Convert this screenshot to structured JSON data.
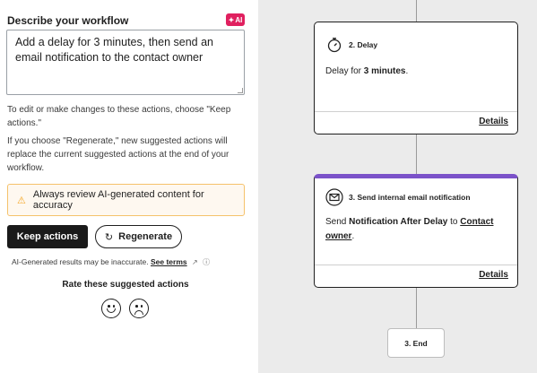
{
  "panel": {
    "title": "Describe your workflow",
    "ai_badge": "AI",
    "prompt_value": "Add a delay for 3 minutes, then send an email notification to the contact owner",
    "help_text_1": "To edit or make changes to these actions, choose \"Keep actions.\"",
    "help_text_2": "If you choose \"Regenerate,\" new suggested actions will replace the current suggested actions at the end of your workflow.",
    "alert_text": "Always review AI-generated content for accuracy",
    "keep_label": "Keep actions",
    "regenerate_label": "Regenerate",
    "disclaimer_text": "AI-Generated results may be inaccurate.",
    "see_terms": "See terms",
    "rate_title": "Rate these suggested actions"
  },
  "canvas": {
    "delay_card": {
      "title": "2. Delay",
      "body_prefix": "Delay for ",
      "body_bold": "3 minutes",
      "body_suffix": ".",
      "details": "Details"
    },
    "email_card": {
      "title": "3. Send internal email notification",
      "body_prefix": "Send ",
      "body_bold": "Notification After Delay",
      "body_mid": " to ",
      "body_link": "Contact owner",
      "body_suffix": ".",
      "details": "Details",
      "accent_color": "#7b52c9"
    },
    "end_node": "3. End"
  },
  "colors": {
    "ai_badge": "#e0205f",
    "alert_border": "#f5c26b",
    "alert_bg": "#fef8f0",
    "primary_button": "#1a1a1a"
  },
  "icons": {
    "ai_badge": "sparkle-icon",
    "alert": "warning-icon",
    "regenerate": "refresh-icon",
    "see_terms": "external-link-icon",
    "info": "info-icon",
    "delay_card": "stopwatch-icon",
    "email_card": "email-icon",
    "rate_positive": "smiley-face-icon",
    "rate_negative": "sad-face-icon"
  }
}
